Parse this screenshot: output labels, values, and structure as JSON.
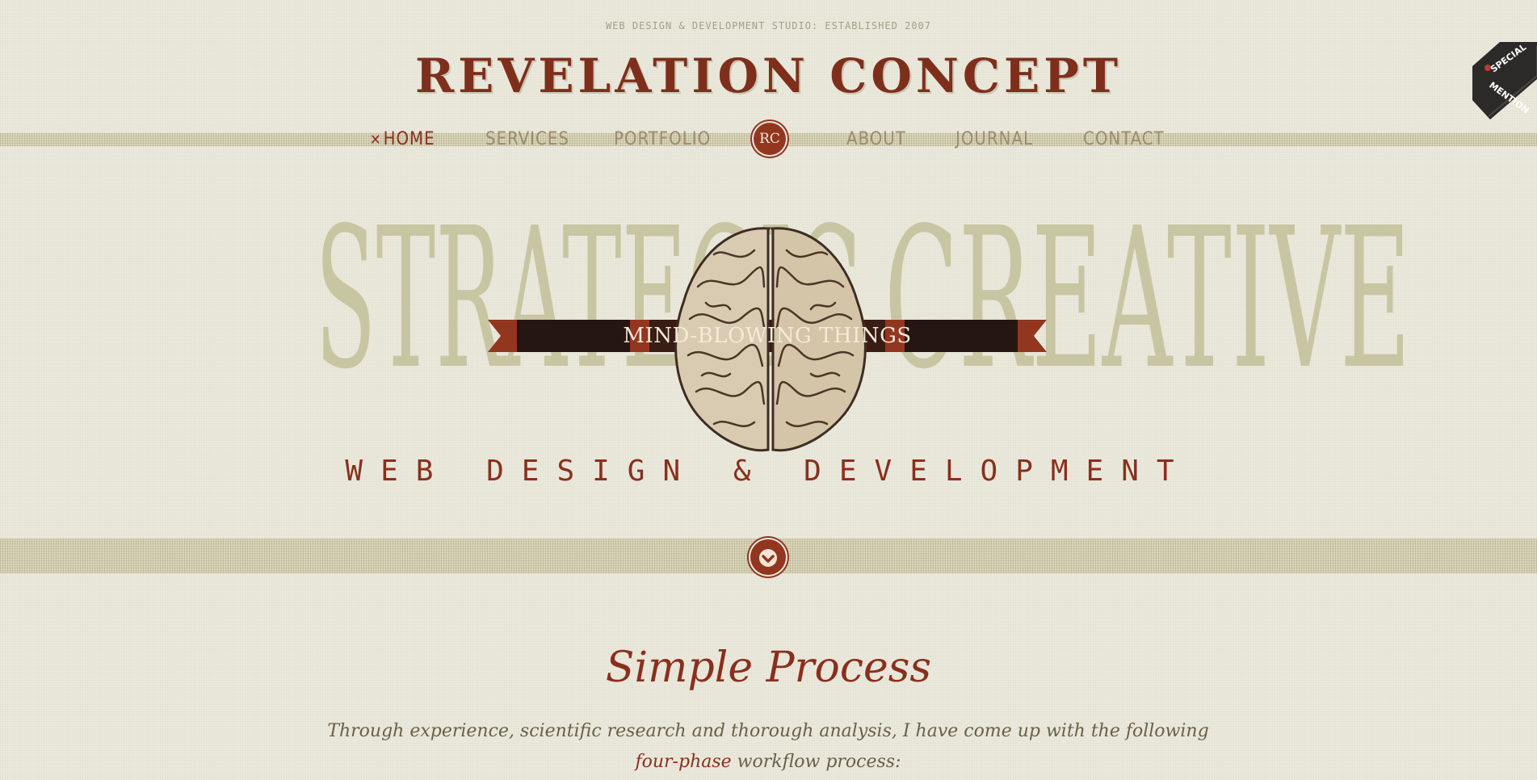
{
  "header": {
    "tagline": "WEB DESIGN & DEVELOPMENT STUDIO: ESTABLISHED 2007",
    "logo": "REVELATION CONCEPT"
  },
  "nav": {
    "items": [
      {
        "label": "HOME",
        "active": true
      },
      {
        "label": "SERVICES",
        "active": false
      },
      {
        "label": "PORTFOLIO",
        "active": false
      },
      {
        "label": "ABOUT",
        "active": false
      },
      {
        "label": "JOURNAL",
        "active": false
      },
      {
        "label": "CONTACT",
        "active": false
      }
    ],
    "active_marker": "✕",
    "logo_monogram": "RC"
  },
  "badge": {
    "line1": "SPECIAL",
    "line2": "MENTION"
  },
  "hero": {
    "word_left": "STRATEGIC",
    "word_right": "CREATIVE",
    "banner": "MIND-BLOWING THINGS",
    "subheading": "WEB DESIGN & DEVELOPMENT"
  },
  "scroll_button": {
    "icon": "chevron-down-icon"
  },
  "process": {
    "title": "Simple Process",
    "intro_before": "Through experience, scientific research and thorough analysis, I have come up with the following ",
    "intro_highlight": "four-phase",
    "intro_after": " workflow process:"
  },
  "colors": {
    "accent": "#8a2f1d",
    "background": "#ebe9dd",
    "nav_text": "#9c8a6c",
    "hero_word": "#c8c6a2"
  }
}
